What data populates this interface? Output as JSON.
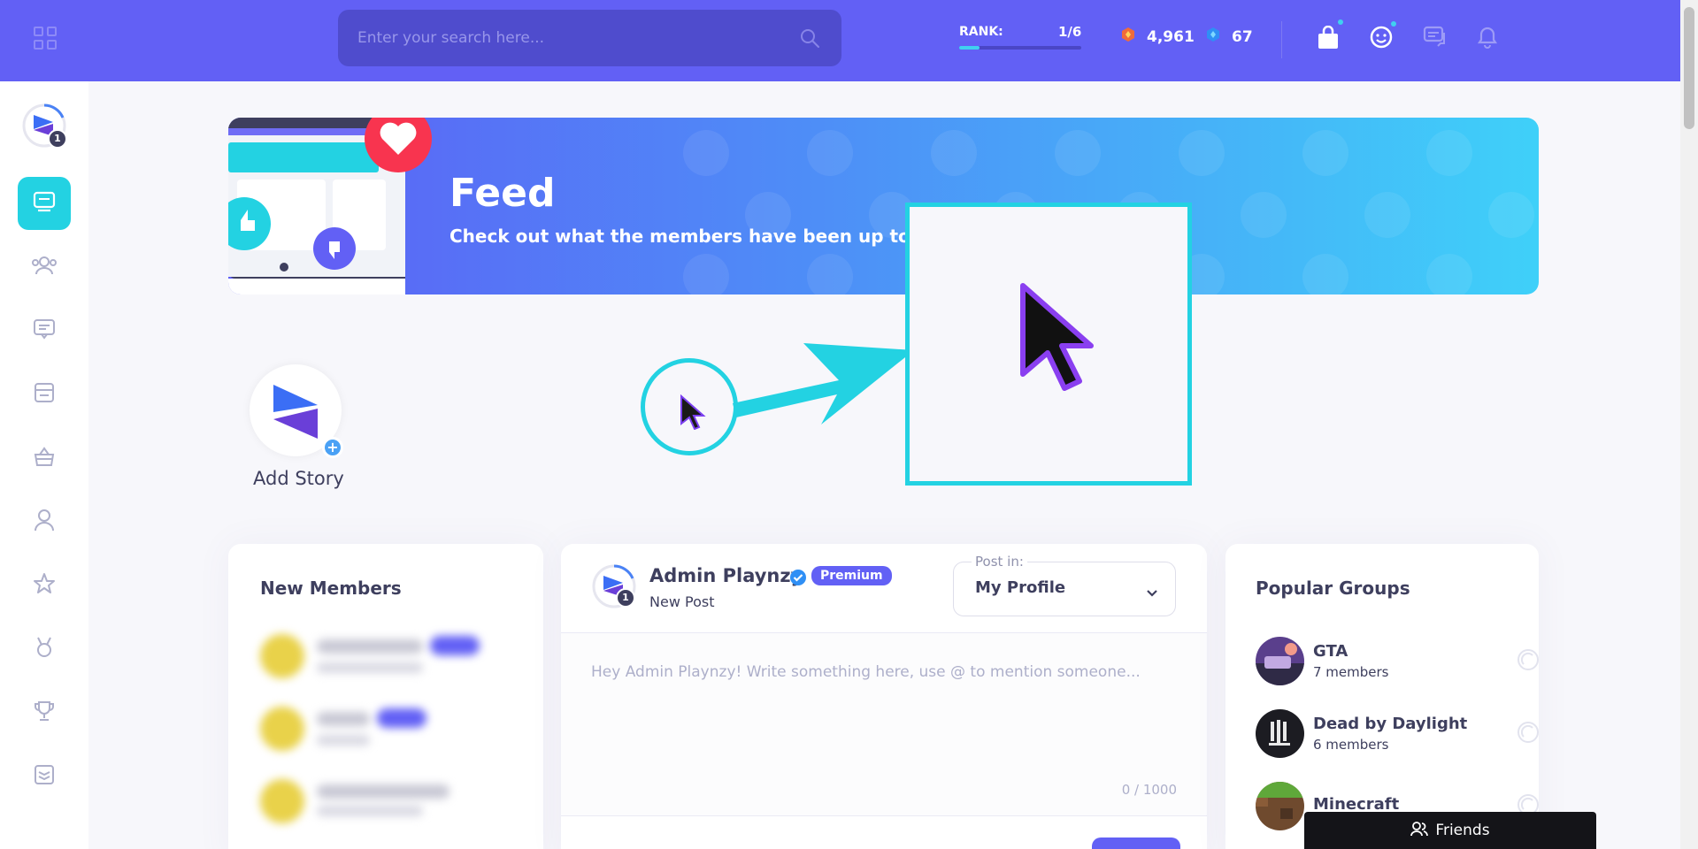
{
  "topbar": {
    "search_placeholder": "Enter your search here...",
    "rank_label": "RANK:",
    "rank_value": "1/6",
    "rank_progress": 0.17,
    "currency_1": "4,961",
    "currency_2": "67",
    "icons": [
      "grid-icon",
      "search-icon",
      "shopping-bag-icon",
      "smiley-icon",
      "messages-icon",
      "bell-icon"
    ]
  },
  "sidebar": {
    "avatar_badge": "1",
    "items": [
      "newsfeed",
      "members",
      "forums",
      "badges",
      "marketplace",
      "profile",
      "favorites",
      "quests",
      "achievements",
      "stack"
    ]
  },
  "banner": {
    "title": "Feed",
    "subtitle": "Check out what the members have been up to!"
  },
  "story": {
    "label": "Add Story",
    "plus": "+"
  },
  "new_members": {
    "title": "New Members"
  },
  "post": {
    "author": "Admin Playnzy",
    "badge": "Premium",
    "sub": "New Post",
    "avatar_badge": "1",
    "post_in_label": "Post in:",
    "post_in_value": "My Profile",
    "placeholder": "Hey Admin Playnzy! Write something here, use @ to mention someone...",
    "counter": "0 / 1000"
  },
  "popular_groups": {
    "title": "Popular Groups",
    "groups": [
      {
        "name": "GTA",
        "members": "7 members"
      },
      {
        "name": "Dead by Daylight",
        "members": "6 members"
      },
      {
        "name": "Minecraft",
        "members": ""
      }
    ]
  },
  "friends": {
    "label": "Friends"
  },
  "colors": {
    "primary": "#6260f5",
    "accent": "#23d2e2",
    "text": "#3e3f5e"
  }
}
